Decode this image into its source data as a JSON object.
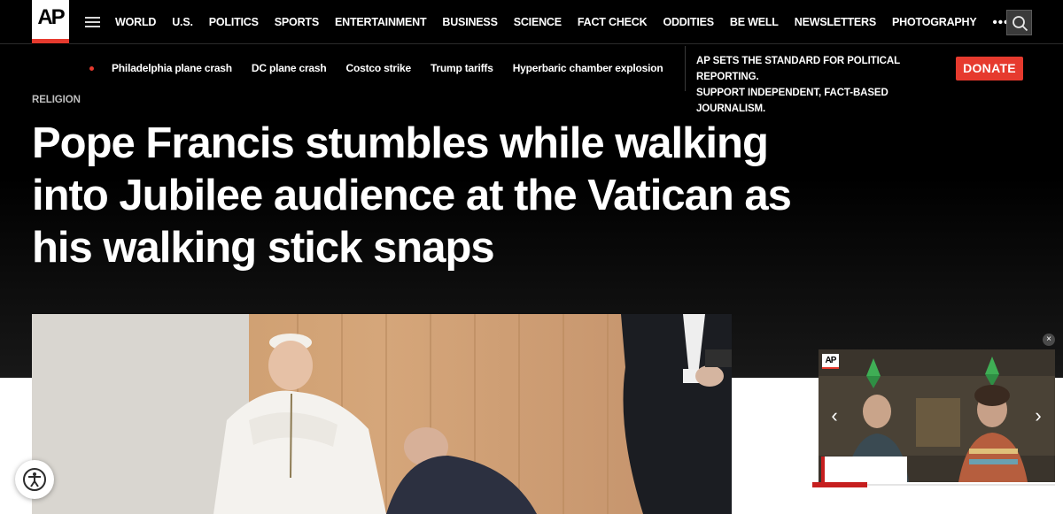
{
  "brand": {
    "logo_text": "AP",
    "accent_color": "#e63a2e"
  },
  "nav": {
    "menu_icon": "hamburger-menu-icon",
    "items": [
      "WORLD",
      "U.S.",
      "POLITICS",
      "SPORTS",
      "ENTERTAINMENT",
      "BUSINESS",
      "SCIENCE",
      "FACT CHECK",
      "ODDITIES",
      "BE WELL",
      "NEWSLETTERS",
      "PHOTOGRAPHY"
    ],
    "more_label": "•••",
    "search_icon": "search-icon"
  },
  "trending": {
    "links": [
      "Philadelphia plane crash",
      "DC plane crash",
      "Costco strike",
      "Trump tariffs",
      "Hyperbaric chamber explosion"
    ]
  },
  "promo": {
    "line1": "AP SETS THE STANDARD FOR POLITICAL REPORTING.",
    "line2": "SUPPORT INDEPENDENT, FACT-BASED JOURNALISM.",
    "donate_label": "DONATE"
  },
  "article": {
    "kicker": "RELIGION",
    "headline": "Pope Francis stumbles while walking into Jubilee audience at the Vatican as his walking stick snaps"
  },
  "video": {
    "logo_text": "AP",
    "close_label": "×",
    "prev_label": "‹",
    "next_label": "›"
  },
  "accessibility": {
    "icon": "accessibility-icon"
  }
}
